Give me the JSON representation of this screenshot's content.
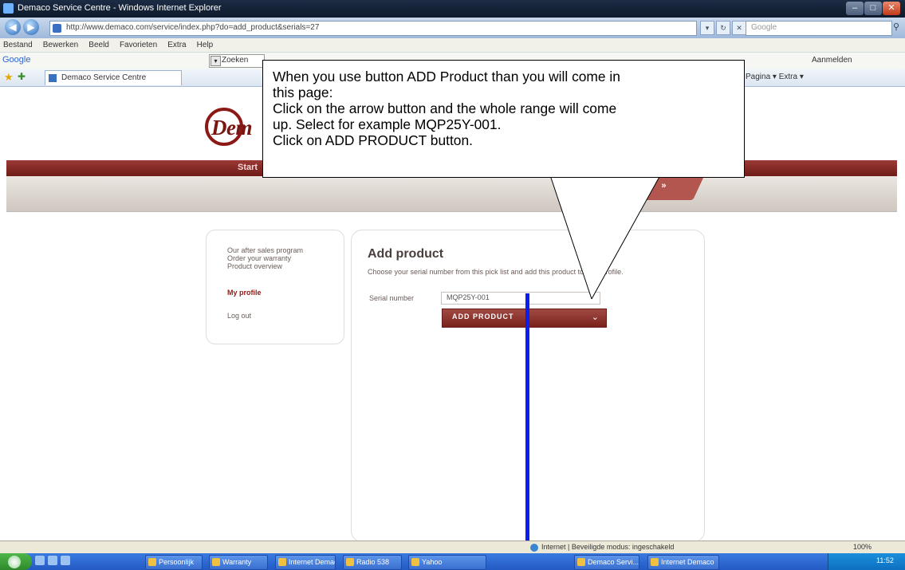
{
  "window": {
    "title": "Demaco Service Centre - Windows Internet Explorer"
  },
  "address_bar": {
    "url": "http://www.demaco.com/service/index.php?do=add_product&serials=27",
    "search_placeholder": "Google"
  },
  "menu": [
    "Bestand",
    "Bewerken",
    "Beeld",
    "Favorieten",
    "Extra",
    "Help"
  ],
  "google_toolbar": {
    "logo": "Google",
    "selected": "Zoeken",
    "right_label": "Aanmelden"
  },
  "favorites_bar": {
    "tab_label": "Demaco Service Centre",
    "commands": "Pagina ▾  Extra ▾"
  },
  "site": {
    "logo_text": "Dem",
    "nav_start": "Start",
    "nav_tab": "»"
  },
  "sidebar": {
    "links": [
      "Our after sales program",
      "Order your warranty",
      "Product overview"
    ],
    "my_profile": "My profile",
    "log_out": "Log out"
  },
  "main": {
    "heading": "Add product",
    "description": "Choose your serial number from this pick list and add this product to your profile.",
    "serial_label": "Serial number",
    "serial_value": "MQP25Y-001",
    "add_button": "ADD PRODUCT"
  },
  "callout": {
    "lines": [
      "When you use button ADD Product than you will come in",
      "this page:",
      "Click on the arrow button and the whole range will come",
      "up. Select for example MQP25Y-001.",
      "Click on ADD PRODUCT button."
    ]
  },
  "statusbar": {
    "zone": "Internet | Beveiligde modus: ingeschakeld",
    "zoom": "100%"
  },
  "taskbar": {
    "items": [
      "Persoonlijk",
      "Warranty",
      "Internet Demaco",
      "Radio 538",
      "Yahoo",
      "Demaco Servi...",
      "Internet Demaco"
    ],
    "clock": "11:52"
  },
  "colors": {
    "brand_dark_red": "#7a1612",
    "annotation_line": "#0b1ef0"
  }
}
